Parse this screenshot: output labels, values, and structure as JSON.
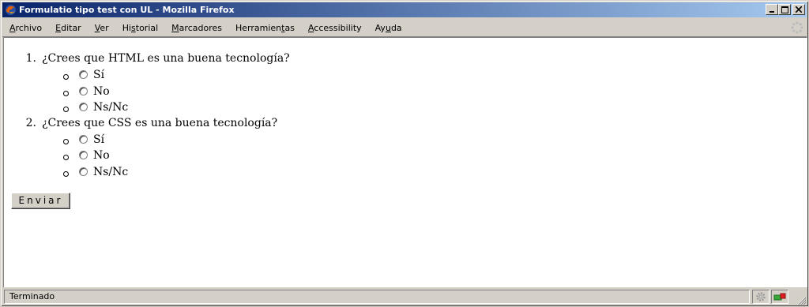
{
  "window": {
    "title": "Formulatio tipo test con UL - Mozilla Firefox"
  },
  "menu": [
    {
      "label": "Archivo",
      "accel_index": 0
    },
    {
      "label": "Editar",
      "accel_index": 0
    },
    {
      "label": "Ver",
      "accel_index": 0
    },
    {
      "label": "Historial",
      "accel_index": 2
    },
    {
      "label": "Marcadores",
      "accel_index": 0
    },
    {
      "label": "Herramientas",
      "accel_index": 9
    },
    {
      "label": "Accessibility",
      "accel_index": 0
    },
    {
      "label": "Ayuda",
      "accel_index": 2
    }
  ],
  "form": {
    "questions": [
      {
        "number": "1.",
        "text": "¿Crees que HTML es una buena tecnología?",
        "options": [
          "Sí",
          "No",
          "Ns/Nc"
        ]
      },
      {
        "number": "2.",
        "text": "¿Crees que CSS es una buena tecnología?",
        "options": [
          "Sí",
          "No",
          "Ns/Nc"
        ]
      }
    ],
    "submit_label": "Enviar"
  },
  "status": {
    "text": "Terminado"
  },
  "icons": {
    "app": "firefox-icon",
    "throbber": "throbber-icon",
    "status_activity": "gear-icon",
    "status_connection": "connection-icon",
    "resize": "resize-grip-icon"
  }
}
